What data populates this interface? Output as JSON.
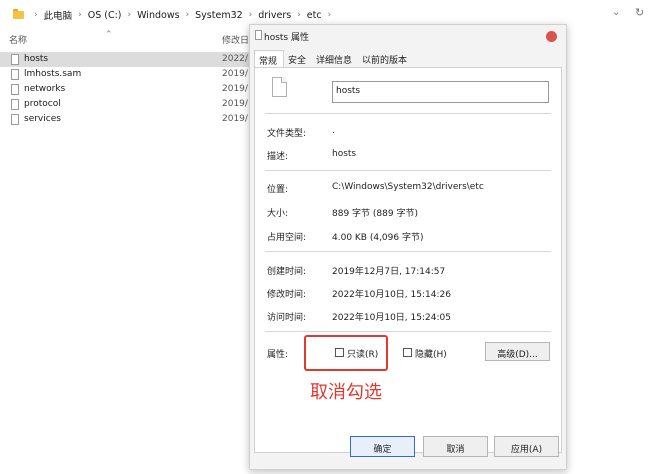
{
  "explorer": {
    "breadcrumbs": [
      "此电脑",
      "OS (C:)",
      "Windows",
      "System32",
      "drivers",
      "etc"
    ],
    "column_name": "名称",
    "column_date": "修改日",
    "files": [
      {
        "name": "hosts",
        "date": "2022/",
        "selected": true
      },
      {
        "name": "lmhosts.sam",
        "date": "2019/"
      },
      {
        "name": "networks",
        "date": "2019/"
      },
      {
        "name": "protocol",
        "date": "2019/"
      },
      {
        "name": "services",
        "date": "2019/"
      }
    ]
  },
  "dialog": {
    "title": "hosts 属性",
    "tabs": [
      "常规",
      "安全",
      "详细信息",
      "以前的版本"
    ],
    "active_tab": "常规",
    "file_name": "hosts",
    "type_label": "文件类型:",
    "type_value": ".",
    "desc_label": "描述:",
    "desc_value": "hosts",
    "location_label": "位置:",
    "location_value": "C:\\Windows\\System32\\drivers\\etc",
    "size_label": "大小:",
    "size_value": "889 字节 (889 字节)",
    "disk_label": "占用空间:",
    "disk_value": "4.00 KB (4,096 字节)",
    "created_label": "创建时间:",
    "created_value": "2019年12月7日, 17:14:57",
    "modified_label": "修改时间:",
    "modified_value": "2022年10月10日, 15:14:26",
    "accessed_label": "访问时间:",
    "accessed_value": "2022年10月10日, 15:24:05",
    "attr_label": "属性:",
    "readonly_label": "只读(R)",
    "hidden_label": "隐藏(H)",
    "advanced_label": "高级(D)...",
    "ok_label": "确定",
    "cancel_label": "取消",
    "apply_label": "应用(A)"
  },
  "annotation": {
    "text": "取消勾选",
    "color": "#e03a2f"
  }
}
